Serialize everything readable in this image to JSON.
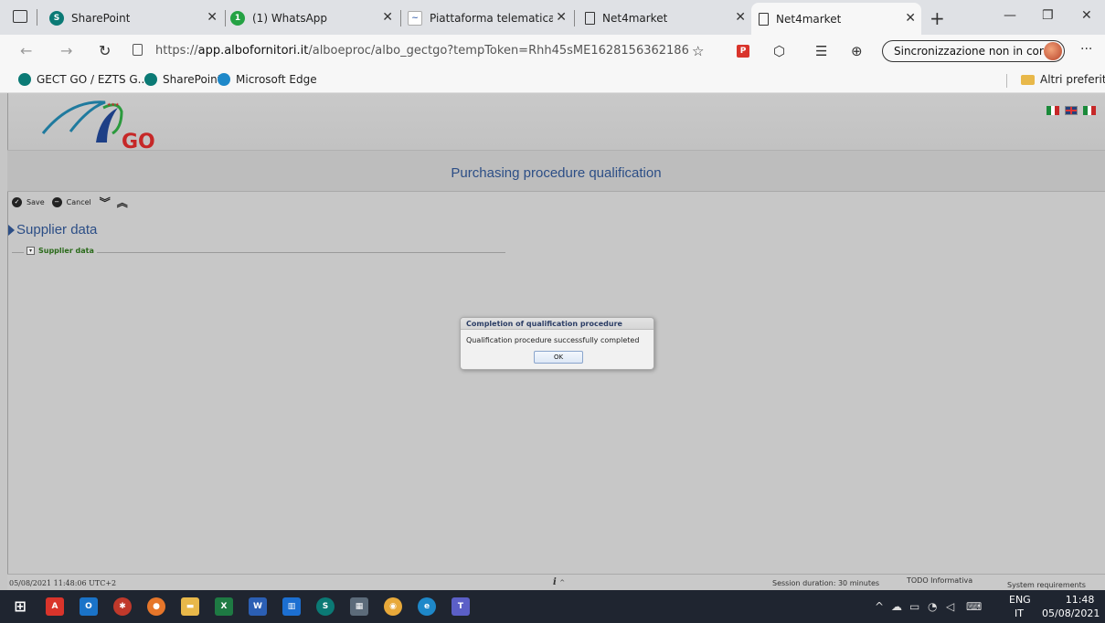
{
  "browser": {
    "tabs": [
      {
        "label": "SharePoint",
        "icon": "sharepoint-icon",
        "color": "#0b7a75"
      },
      {
        "label": "(1) WhatsApp",
        "icon": "whatsapp-icon",
        "color": "#25a244"
      },
      {
        "label": "Piattaforma telematica di",
        "icon": "portal-icon",
        "color": "#4a6fb5"
      },
      {
        "label": "Net4market",
        "icon": "page-icon",
        "color": "#333333"
      },
      {
        "label": "Net4market",
        "icon": "page-icon",
        "color": "#333333"
      }
    ],
    "url_prefix": "https://",
    "url_host": "app.albofornitori.it",
    "url_path": "/alboeproc/albo_gectgo?tempToken=Rhh45sME1628156362186",
    "sync_label": "Sincronizzazione non in corso",
    "favorites": [
      {
        "label": "GECT GO / EZTS G...",
        "color": "#0b7a75"
      },
      {
        "label": "SharePoint",
        "color": "#0b7a75"
      },
      {
        "label": "Microsoft Edge",
        "color": "#1e88c9"
      }
    ],
    "other_favorites": "Altri preferiti"
  },
  "page": {
    "logo_text": "GO",
    "title": "Purchasing procedure qualification",
    "toolbar": {
      "save_label": "Save",
      "cancel_label": "Cancel"
    },
    "section_title": "Supplier data",
    "fieldset_legend": "Supplier data",
    "dialog": {
      "title": "Completion of qualification procedure",
      "message": "Qualification procedure successfully completed",
      "ok_label": "OK"
    },
    "status": {
      "timestamp": "05/08/2021 11:48:06 UTC+2",
      "info_glyph": "i",
      "session": "Session duration: 30 minutes",
      "todo": "TODO Informativa",
      "requirements": "System requirements"
    }
  },
  "taskbar": {
    "lang_top": "ENG",
    "lang_bottom": "IT",
    "time": "11:48",
    "date": "05/08/2021"
  }
}
